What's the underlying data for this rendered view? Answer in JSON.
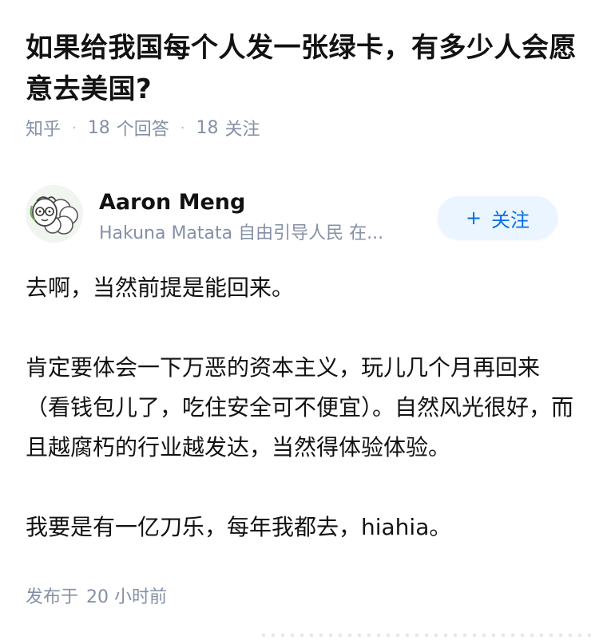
{
  "question": {
    "title": "如果给我国每个人发一张绿卡，有多少人会愿意去美国?",
    "source": "知乎",
    "answers_count": "18",
    "answers_label": "个回答",
    "followers_count": "18",
    "followers_label": "关注"
  },
  "author": {
    "name": "Aaron Meng",
    "bio": "Hakuna Matata 自由引导人民 在...",
    "avatar_icon": "sheep-avatar-icon",
    "follow_plus": "+",
    "follow_label": "关注"
  },
  "answer": {
    "paragraphs": [
      "去啊，当然前提是能回来。",
      "肯定要体会一下万恶的资本主义，玩儿几个月再回来（看钱包儿了，吃住安全可不便宜）。自然风光很好，而且越腐朽的行业越发达，当然得体验体验。",
      "我要是有一亿刀乐，每年我都去，hiahia。"
    ],
    "publish_label": "发布于",
    "publish_time": "20 小时前"
  },
  "colors": {
    "title": "#121212",
    "meta": "#8590a6",
    "accent": "#056de8",
    "follow_bg": "#ebf5ff"
  }
}
